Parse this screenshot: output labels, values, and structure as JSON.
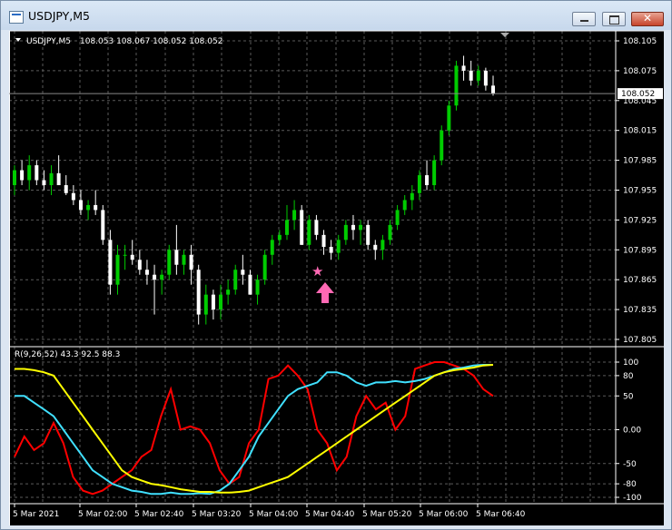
{
  "window": {
    "title": "USDJPY,M5",
    "icon": "chart-window-icon",
    "buttons": {
      "minimize": "minimize-icon",
      "maximize": "maximize-icon",
      "close": "close-icon"
    }
  },
  "chart": {
    "symbol_header": "USDJPY,M5",
    "ohlc_text": "108.053 108.067 108.052 108.052",
    "current_price_label": "108.052",
    "arrow_marker": {
      "icon": "pink-up-arrow-icon",
      "color": "#ff69b4"
    },
    "star_marker": {
      "icon": "pink-star-icon",
      "color": "#ff69b4"
    },
    "colors": {
      "background": "#000000",
      "grid": "#5a5a5a",
      "bull": "#00cc00",
      "bear": "#ffffff",
      "axis_text": "#ffffff"
    }
  },
  "indicator": {
    "header": "R(9,26,52) 43.3 92.5 88.3",
    "colors": {
      "red": "#ff0000",
      "cyan": "#40e0ff",
      "yellow": "#ffff00"
    }
  },
  "chart_data": [
    {
      "type": "candlestick",
      "title": "USDJPY,M5",
      "y_ticks": [
        "108.105",
        "108.075",
        "108.045",
        "108.015",
        "107.985",
        "107.955",
        "107.925",
        "107.895",
        "107.865",
        "107.835",
        "107.805"
      ],
      "ylim": [
        107.805,
        108.105
      ],
      "x_ticks": [
        "5 Mar 2021",
        "5 Mar 02:00",
        "5 Mar 02:40",
        "5 Mar 03:20",
        "5 Mar 04:00",
        "5 Mar 04:40",
        "5 Mar 05:20",
        "5 Mar 06:00",
        "5 Mar 06:40"
      ],
      "last_price": 108.052,
      "candles": [
        [
          107.96,
          107.98,
          107.95,
          107.975
        ],
        [
          107.975,
          107.985,
          107.96,
          107.965
        ],
        [
          107.965,
          107.99,
          107.955,
          107.98
        ],
        [
          107.98,
          107.985,
          107.96,
          107.965
        ],
        [
          107.965,
          107.975,
          107.955,
          107.96
        ],
        [
          107.96,
          107.98,
          107.95,
          107.972
        ],
        [
          107.972,
          107.99,
          107.96,
          107.96
        ],
        [
          107.96,
          107.97,
          107.95,
          107.952
        ],
        [
          107.952,
          107.96,
          107.94,
          107.945
        ],
        [
          107.945,
          107.955,
          107.93,
          107.935
        ],
        [
          107.935,
          107.945,
          107.925,
          107.94
        ],
        [
          107.94,
          107.955,
          107.93,
          107.935
        ],
        [
          107.935,
          107.94,
          107.9,
          107.905
        ],
        [
          107.905,
          107.915,
          107.85,
          107.86
        ],
        [
          107.86,
          107.9,
          107.85,
          107.89
        ],
        [
          107.89,
          107.9,
          107.875,
          107.89
        ],
        [
          107.89,
          107.905,
          107.88,
          107.885
        ],
        [
          107.885,
          107.895,
          107.87,
          107.875
        ],
        [
          107.875,
          107.885,
          107.86,
          107.87
        ],
        [
          107.87,
          107.88,
          107.83,
          107.865
        ],
        [
          107.865,
          107.875,
          107.85,
          107.87
        ],
        [
          107.87,
          107.9,
          107.865,
          107.895
        ],
        [
          107.895,
          107.92,
          107.87,
          107.88
        ],
        [
          107.88,
          107.895,
          107.87,
          107.89
        ],
        [
          107.89,
          107.9,
          107.86,
          107.875
        ],
        [
          107.875,
          107.88,
          107.82,
          107.83
        ],
        [
          107.83,
          107.86,
          107.82,
          107.85
        ],
        [
          107.85,
          107.855,
          107.825,
          107.835
        ],
        [
          107.835,
          107.86,
          107.825,
          107.85
        ],
        [
          107.85,
          107.865,
          107.84,
          107.855
        ],
        [
          107.855,
          107.88,
          107.85,
          107.875
        ],
        [
          107.875,
          107.89,
          107.86,
          107.87
        ],
        [
          107.87,
          107.875,
          107.85,
          107.85
        ],
        [
          107.85,
          107.87,
          107.84,
          107.865
        ],
        [
          107.865,
          107.895,
          107.86,
          107.89
        ],
        [
          107.89,
          107.91,
          107.88,
          107.905
        ],
        [
          107.905,
          107.915,
          107.9,
          107.91
        ],
        [
          107.91,
          107.94,
          107.905,
          107.925
        ],
        [
          107.925,
          107.945,
          107.915,
          107.935
        ],
        [
          107.935,
          107.94,
          107.9,
          107.9
        ],
        [
          107.9,
          107.93,
          107.895,
          107.925
        ],
        [
          107.925,
          107.93,
          107.905,
          107.91
        ],
        [
          107.91,
          107.915,
          107.89,
          107.898
        ],
        [
          107.898,
          107.905,
          107.885,
          107.892
        ],
        [
          107.892,
          107.91,
          107.885,
          107.905
        ],
        [
          107.905,
          107.925,
          107.9,
          107.92
        ],
        [
          107.92,
          107.93,
          107.905,
          107.915
        ],
        [
          107.915,
          107.925,
          107.9,
          107.92
        ],
        [
          107.92,
          107.925,
          107.895,
          107.9
        ],
        [
          107.9,
          107.905,
          107.885,
          107.895
        ],
        [
          107.895,
          107.91,
          107.885,
          107.905
        ],
        [
          107.905,
          107.925,
          107.9,
          107.92
        ],
        [
          107.92,
          107.94,
          107.915,
          107.935
        ],
        [
          107.935,
          107.95,
          107.93,
          107.945
        ],
        [
          107.945,
          107.96,
          107.935,
          107.952
        ],
        [
          107.952,
          107.975,
          107.945,
          107.97
        ],
        [
          107.97,
          107.985,
          107.955,
          107.96
        ],
        [
          107.96,
          107.99,
          107.955,
          107.985
        ],
        [
          107.985,
          108.02,
          107.98,
          108.015
        ],
        [
          108.015,
          108.045,
          108.01,
          108.04
        ],
        [
          108.04,
          108.085,
          108.035,
          108.08
        ],
        [
          108.08,
          108.09,
          108.065,
          108.075
        ],
        [
          108.075,
          108.085,
          108.06,
          108.065
        ],
        [
          108.065,
          108.08,
          108.06,
          108.075
        ],
        [
          108.075,
          108.078,
          108.055,
          108.06
        ],
        [
          108.06,
          108.07,
          108.05,
          108.052
        ]
      ]
    },
    {
      "type": "line",
      "title": "R(9,26,52) 43.3 92.5 88.3",
      "y_ticks": [
        "100",
        "80",
        "50",
        "0.00",
        "-50",
        "-80",
        "-100"
      ],
      "ylim": [
        -100,
        100
      ],
      "series": [
        {
          "color": "#ff0000",
          "values": [
            -40,
            -10,
            -30,
            -20,
            10,
            -20,
            -70,
            -90,
            -95,
            -90,
            -80,
            -70,
            -60,
            -40,
            -30,
            20,
            60,
            0,
            5,
            0,
            -20,
            -60,
            -80,
            -70,
            -20,
            0,
            75,
            80,
            95,
            80,
            60,
            0,
            -20,
            -60,
            -40,
            20,
            50,
            30,
            40,
            0,
            20,
            90,
            95,
            100,
            100,
            95,
            90,
            80,
            60,
            50
          ]
        },
        {
          "color": "#40e0ff",
          "values": [
            50,
            50,
            40,
            30,
            20,
            0,
            -20,
            -40,
            -60,
            -70,
            -80,
            -85,
            -90,
            -92,
            -95,
            -95,
            -93,
            -95,
            -95,
            -94,
            -95,
            -90,
            -80,
            -60,
            -40,
            -10,
            10,
            30,
            50,
            60,
            65,
            70,
            85,
            85,
            80,
            70,
            65,
            70,
            70,
            72,
            70,
            72,
            75,
            80,
            85,
            90,
            92,
            95,
            96,
            96
          ]
        },
        {
          "color": "#ffff00",
          "values": [
            90,
            90,
            88,
            85,
            80,
            60,
            40,
            20,
            0,
            -20,
            -40,
            -60,
            -70,
            -75,
            -80,
            -82,
            -85,
            -88,
            -90,
            -92,
            -92,
            -93,
            -93,
            -92,
            -90,
            -85,
            -80,
            -75,
            -70,
            -60,
            -50,
            -40,
            -30,
            -20,
            -10,
            0,
            10,
            20,
            30,
            40,
            50,
            60,
            70,
            80,
            85,
            88,
            90,
            92,
            95,
            96
          ]
        }
      ]
    }
  ]
}
